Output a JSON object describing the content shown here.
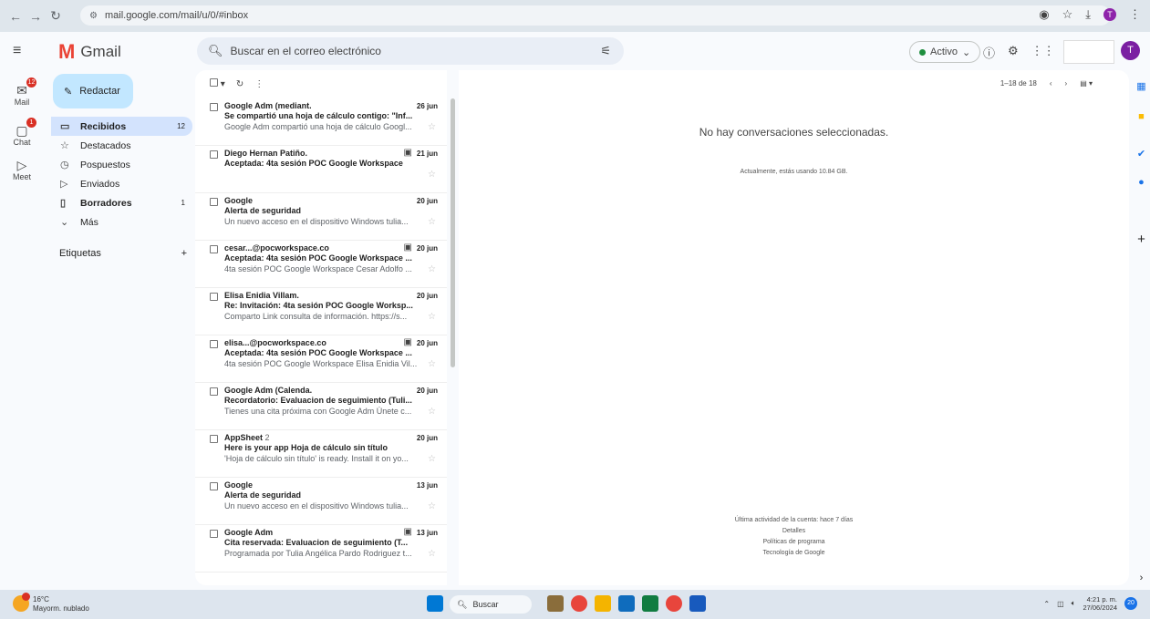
{
  "browser": {
    "url": "mail.google.com/mail/u/0/#inbox"
  },
  "rail": {
    "items": [
      {
        "label": "Mail",
        "badge": "12",
        "icon": "mail-icon"
      },
      {
        "label": "Chat",
        "badge": "1",
        "icon": "chat-icon"
      },
      {
        "label": "Meet",
        "badge": "",
        "icon": "video-icon"
      }
    ]
  },
  "app": {
    "name": "Gmail"
  },
  "search": {
    "placeholder": "Buscar en el correo electrónico"
  },
  "status": {
    "label": "Activo"
  },
  "user": {
    "initial": "T"
  },
  "compose": {
    "label": "Redactar"
  },
  "nav": {
    "items": [
      {
        "label": "Recibidos",
        "count": "12",
        "icon": "inbox-icon"
      },
      {
        "label": "Destacados",
        "count": "",
        "icon": "star-icon"
      },
      {
        "label": "Pospuestos",
        "count": "",
        "icon": "clock-icon"
      },
      {
        "label": "Enviados",
        "count": "",
        "icon": "send-icon"
      },
      {
        "label": "Borradores",
        "count": "1",
        "icon": "draft-icon"
      },
      {
        "label": "Más",
        "count": "",
        "icon": "chevron-down-icon"
      }
    ]
  },
  "labels": {
    "title": "Etiquetas",
    "add": "+"
  },
  "list": {
    "pagination": "1–18 de 18",
    "emails": [
      {
        "from": "Google Adm (mediant.",
        "count": "",
        "date": "26 jun",
        "subject": "Se compartió una hoja de cálculo contigo: \"Inf...",
        "snippet": "Google Adm compartió una hoja de cálculo Googl...",
        "calendar": false
      },
      {
        "from": "Diego Hernan Patiño.",
        "count": "",
        "date": "21 jun",
        "subject": "Aceptada: 4ta sesión POC Google Workspace",
        "snippet": "",
        "calendar": true
      },
      {
        "from": "Google",
        "count": "",
        "date": "20 jun",
        "subject": "Alerta de seguridad",
        "snippet": "Un nuevo acceso en el dispositivo Windows tulia...",
        "calendar": false
      },
      {
        "from": "cesar...@pocworkspace.co",
        "count": "",
        "date": "20 jun",
        "subject": "Aceptada: 4ta sesión POC Google Workspace ...",
        "snippet": "4ta sesión POC Google Workspace Cesar Adolfo ...",
        "calendar": true
      },
      {
        "from": "Elisa Enidia Villam.",
        "count": "",
        "date": "20 jun",
        "subject": "Re: Invitación: 4ta sesión POC Google Worksp...",
        "snippet": "Comparto Link consulta de información. https://s...",
        "calendar": false
      },
      {
        "from": "elisa...@pocworkspace.co",
        "count": "",
        "date": "20 jun",
        "subject": "Aceptada: 4ta sesión POC Google Workspace ...",
        "snippet": "4ta sesión POC Google Workspace Elisa Enidia Vil...",
        "calendar": true
      },
      {
        "from": "Google Adm (Calenda.",
        "count": "",
        "date": "20 jun",
        "subject": "Recordatorio: Evaluacion de seguimiento (Tuli...",
        "snippet": "Tienes una cita próxima con Google Adm Únete c...",
        "calendar": false
      },
      {
        "from": "AppSheet",
        "count": "2",
        "date": "20 jun",
        "subject": "Here is your app Hoja de cálculo sin título",
        "snippet": "'Hoja de cálculo sin título' is ready. Install it on yo...",
        "calendar": false
      },
      {
        "from": "Google",
        "count": "",
        "date": "13 jun",
        "subject": "Alerta de seguridad",
        "snippet": "Un nuevo acceso en el dispositivo Windows tulia...",
        "calendar": false
      },
      {
        "from": "Google Adm",
        "count": "",
        "date": "13 jun",
        "subject": "Cita reservada: Evaluacion de seguimiento (T...",
        "snippet": "Programada por Tulia Angélica Pardo Rodriguez t...",
        "calendar": true
      }
    ]
  },
  "reading": {
    "empty": "No hay conversaciones seleccionadas.",
    "storage": "Actualmente, estás usando 10.84 GB.",
    "activity": "Última actividad de la cuenta: hace 7 días",
    "details": "Detalles",
    "policies": "Políticas de programa",
    "tech": "Tecnología de Google"
  },
  "taskbar": {
    "temp": "16°C",
    "weather": "Mayorm. nublado",
    "search": "Buscar",
    "time": "4:21 p. m.",
    "date": "27/06/2024",
    "notif": "20"
  },
  "colors": {
    "accent": "#0b57d0",
    "compose_bg": "#c2e7ff",
    "selected_nav": "#d3e3fd",
    "badge": "#d93025"
  }
}
